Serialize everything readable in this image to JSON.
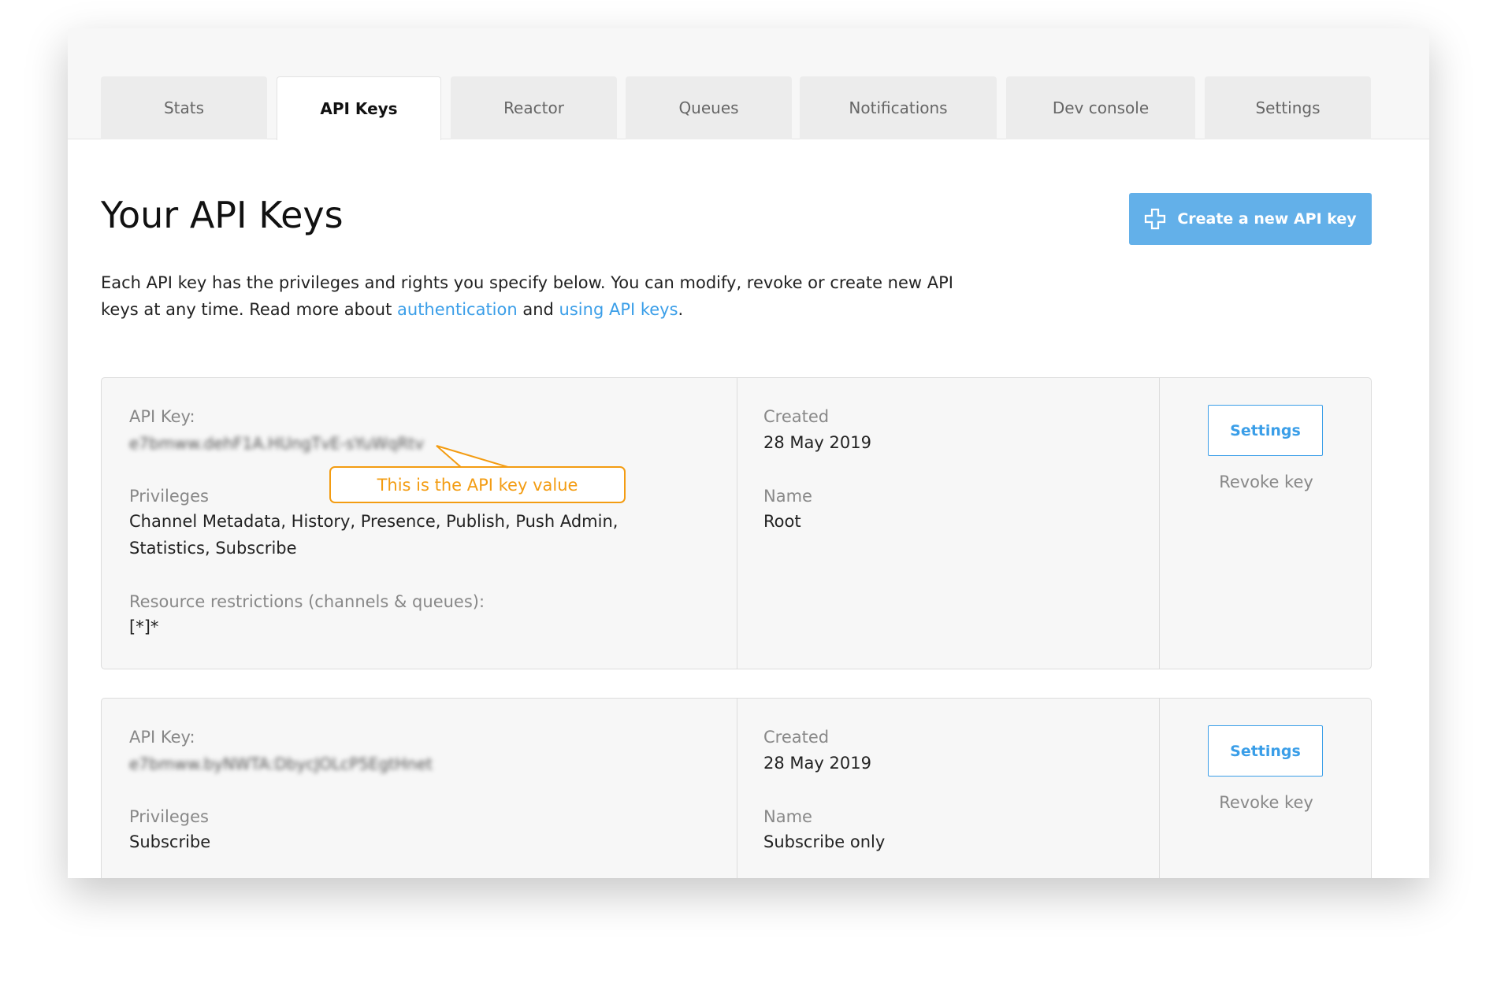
{
  "tabs": [
    {
      "label": "Stats"
    },
    {
      "label": "API Keys"
    },
    {
      "label": "Reactor"
    },
    {
      "label": "Queues"
    },
    {
      "label": "Notifications"
    },
    {
      "label": "Dev console"
    },
    {
      "label": "Settings"
    }
  ],
  "page": {
    "title": "Your API Keys",
    "create_button": "Create a new API key",
    "intro_1": "Each API key has the privileges and rights you specify below. You can modify, revoke or create new API keys at any time. Read more about ",
    "link_auth": "authentication",
    "intro_and": " and ",
    "link_keys": "using API keys",
    "intro_end": "."
  },
  "callout": "This is the API key value",
  "keys": [
    {
      "api_key_label": "API Key:",
      "api_key_value": "e7bmww.dehF1A.HUngTvE-sYuWqRtv",
      "privileges_label": "Privileges",
      "privileges": "Channel Metadata, History, Presence, Publish, Push Admin, Statistics, Subscribe",
      "resource_label": "Resource restrictions (channels & queues):",
      "resource": "[*]*",
      "created_label": "Created",
      "created": "28 May 2019",
      "name_label": "Name",
      "name": "Root",
      "settings": "Settings",
      "revoke": "Revoke key"
    },
    {
      "api_key_label": "API Key:",
      "api_key_value": "e7bmww.byNWTA:DbycJOLcP5EgtHnet",
      "privileges_label": "Privileges",
      "privileges": "Subscribe",
      "created_label": "Created",
      "created": "28 May 2019",
      "name_label": "Name",
      "name": "Subscribe only",
      "settings": "Settings",
      "revoke": "Revoke key"
    }
  ],
  "colors": {
    "accent": "#63b0e9",
    "link": "#3a9ee8",
    "callout": "#f39c12"
  }
}
